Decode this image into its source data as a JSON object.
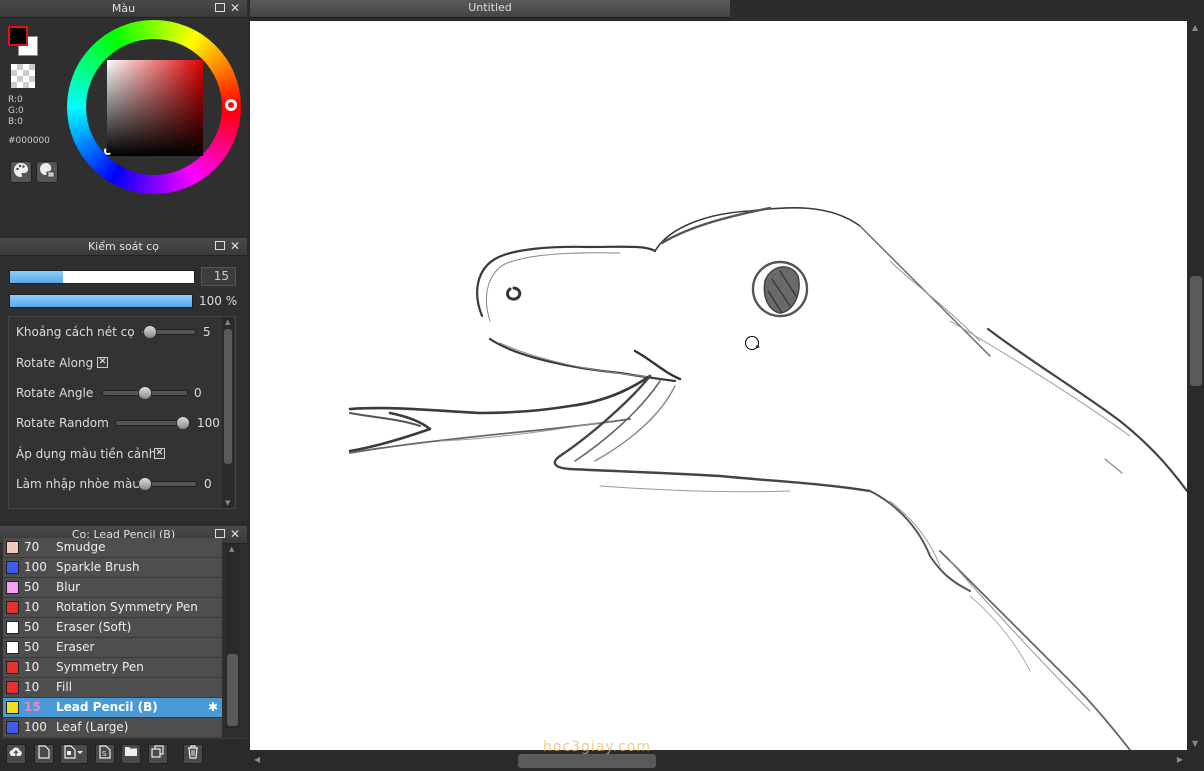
{
  "color_panel": {
    "title": "Màu",
    "rgb": {
      "r": "R:0",
      "g": "G:0",
      "b": "B:0"
    },
    "hex": "#000000",
    "foreground_color": "#000000",
    "background_color": "#ffffff",
    "accent_outline": "#e01010"
  },
  "brush_control": {
    "title": "Kiểm soát cọ",
    "size_value": "15",
    "size_fraction": 0.29,
    "opacity_label": "100 %",
    "opacity_fraction": 1.0,
    "properties": [
      {
        "label": "Khoảng cách nét cọ",
        "value": "5",
        "type": "slider",
        "level": 0.05
      },
      {
        "label": "Rotate Along",
        "type": "checkbox",
        "checked": true
      },
      {
        "label": "Rotate Angle",
        "value": "0",
        "type": "slider",
        "level": 0.5
      },
      {
        "label": "Rotate Random",
        "value": "100",
        "type": "slider",
        "level": 1.0
      },
      {
        "label": "Áp dụng màu tiền cảnh",
        "type": "checkbox",
        "checked": true
      },
      {
        "label": "Làm nhập nhòe màu",
        "value": "0",
        "type": "slider",
        "level": 0.0
      }
    ]
  },
  "brush_list": {
    "title": "Cọ: Lead Pencil (B)",
    "items": [
      {
        "size": "70",
        "name": "Smudge",
        "color": "#f3c9b8"
      },
      {
        "size": "100",
        "name": "Sparkle Brush",
        "color": "#3d5cf0"
      },
      {
        "size": "50",
        "name": "Blur",
        "color": "#f5a0f5"
      },
      {
        "size": "10",
        "name": "Rotation Symmetry Pen",
        "color": "#e83030"
      },
      {
        "size": "50",
        "name": "Eraser (Soft)",
        "color": "#ffffff"
      },
      {
        "size": "50",
        "name": "Eraser",
        "color": "#ffffff"
      },
      {
        "size": "10",
        "name": "Symmetry Pen",
        "color": "#e83030"
      },
      {
        "size": "10",
        "name": "Fill",
        "color": "#e83030"
      },
      {
        "size": "15",
        "name": "Lead Pencil (B)",
        "color": "#f0e020",
        "active": true
      },
      {
        "size": "100",
        "name": "Leaf (Large)",
        "color": "#3d5cf0"
      }
    ],
    "toolbar_icons": [
      "cloud-upload-icon",
      "new-brush-icon",
      "brush-type-icon",
      "script-icon",
      "folder-icon",
      "duplicate-icon",
      "trash-icon"
    ]
  },
  "document": {
    "tab_title": "Untitled",
    "watermark": "hoc3giay.com"
  }
}
